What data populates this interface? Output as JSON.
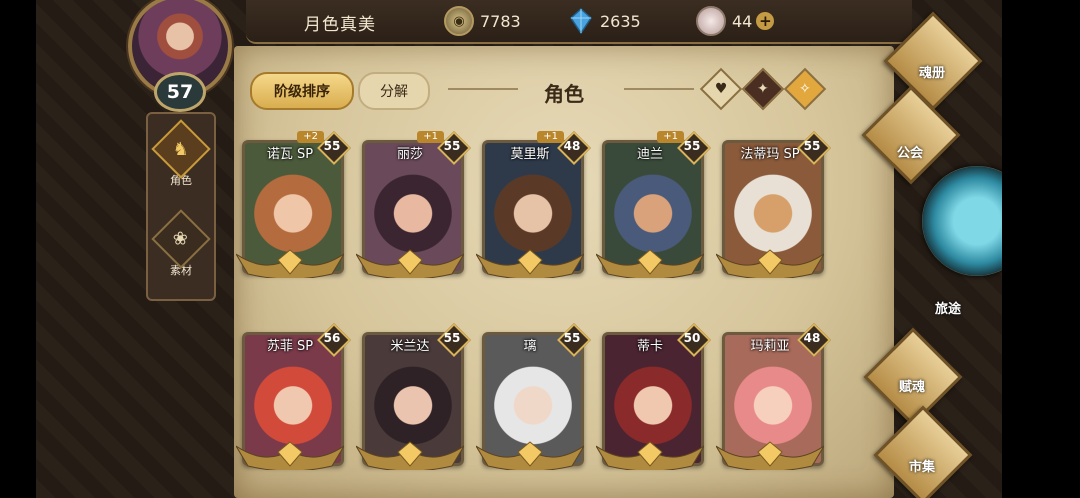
{
  "player": {
    "name": "月色真美",
    "level": "57"
  },
  "resources": [
    {
      "icon": "gold-coin-icon",
      "value": "7783"
    },
    {
      "icon": "blue-gem-icon",
      "value": "2635"
    },
    {
      "icon": "pink-crystal-icon",
      "value": "44"
    }
  ],
  "left_menu": [
    {
      "label": "角色",
      "icon": "helmet-icon"
    },
    {
      "label": "素材",
      "icon": "material-icon"
    }
  ],
  "tabs": {
    "sort_label": "阶级排序",
    "decompose_label": "分解"
  },
  "title": "角色",
  "filters": [
    "heart-filter-icon",
    "sword-filter-icon",
    "star-filter-icon"
  ],
  "characters": [
    {
      "name": "诺瓦 SP",
      "level": "55",
      "plus": "+2"
    },
    {
      "name": "丽莎",
      "level": "55",
      "plus": "+1"
    },
    {
      "name": "莫里斯",
      "level": "48",
      "plus": "+1"
    },
    {
      "name": "迪兰",
      "level": "55",
      "plus": "+1"
    },
    {
      "name": "法蒂玛 SP",
      "level": "55",
      "plus": ""
    },
    {
      "name": "苏菲 SP",
      "level": "56",
      "plus": ""
    },
    {
      "name": "米兰达",
      "level": "55",
      "plus": ""
    },
    {
      "name": "璃",
      "level": "55",
      "plus": ""
    },
    {
      "name": "蒂卡",
      "level": "50",
      "plus": ""
    },
    {
      "name": "玛莉亚",
      "level": "48",
      "plus": ""
    }
  ],
  "side_menu": {
    "soul_book": "魂册",
    "guild": "公会",
    "journey": "旅途",
    "soul_gift": "赋魂",
    "market": "市集"
  },
  "colors": {
    "gold": "#d9b35a",
    "parchment": "#d7c69c",
    "dark": "#3b2d21",
    "teal": "#2e8aa1"
  }
}
